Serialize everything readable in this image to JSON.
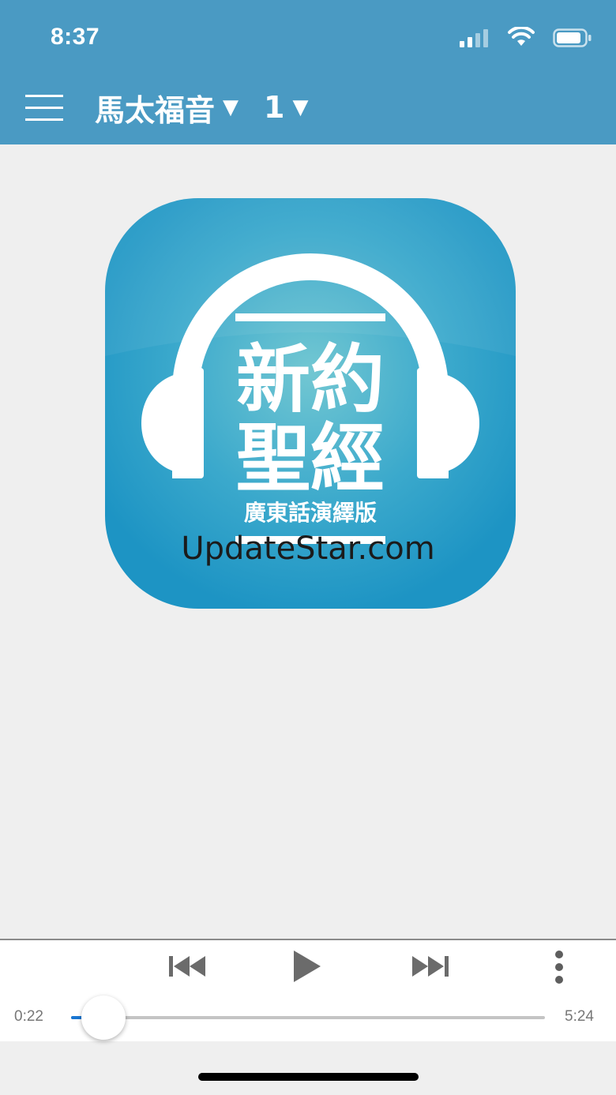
{
  "status_bar": {
    "time": "8:37"
  },
  "nav": {
    "book": "馬太福音",
    "chapter": "1",
    "caret": "▼"
  },
  "artwork": {
    "title_line1": "新約",
    "title_line2": "聖經",
    "subtitle": "廣東話演繹版",
    "colors": {
      "outer": "#1e96c6",
      "inner": "#6cc4cf"
    }
  },
  "watermark": "UpdateStar.com",
  "player": {
    "current_time": "0:22",
    "total_time": "5:24",
    "progress": 0.068,
    "accent": "#1976d2"
  }
}
